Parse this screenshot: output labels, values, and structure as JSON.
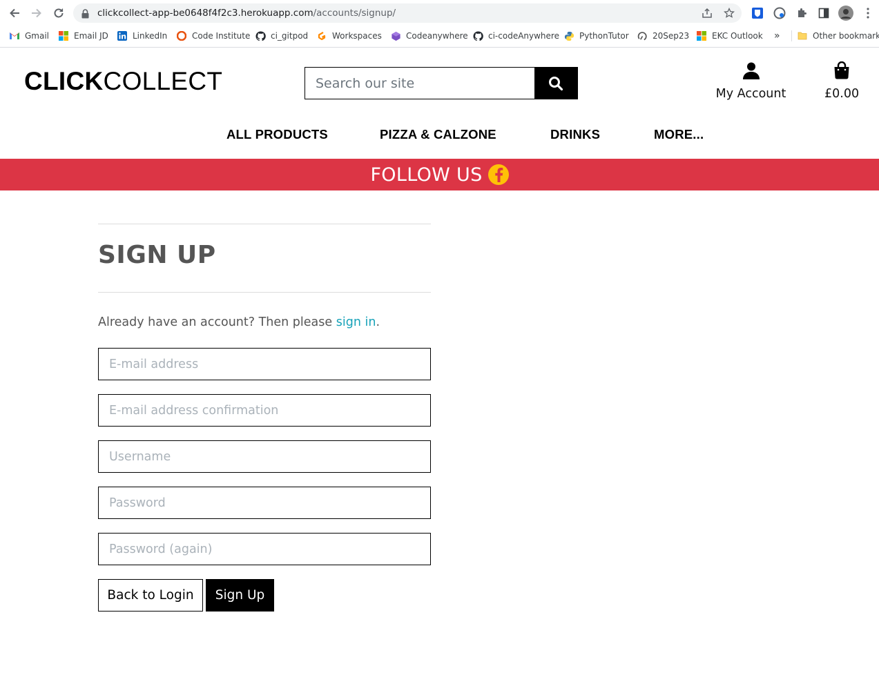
{
  "browser": {
    "url_host": "clickcollect-app-be0648f4f2c3.herokuapp.com",
    "url_path": "/accounts/signup/",
    "bookmarks": [
      {
        "label": "Gmail",
        "icon": "gmail-icon"
      },
      {
        "label": "Email JD",
        "icon": "microsoft-icon"
      },
      {
        "label": "LinkedIn",
        "icon": "linkedin-icon"
      },
      {
        "label": "Code Institute",
        "icon": "code-institute-icon"
      },
      {
        "label": "ci_gitpod",
        "icon": "github-icon"
      },
      {
        "label": "Workspaces",
        "icon": "gitpod-icon"
      },
      {
        "label": "Codeanywhere",
        "icon": "codeanywhere-icon"
      },
      {
        "label": "ci-codeAnywhere",
        "icon": "github-icon"
      },
      {
        "label": "PythonTutor",
        "icon": "python-icon"
      },
      {
        "label": "20Sep23",
        "icon": "loop-icon"
      },
      {
        "label": "EKC Outlook",
        "icon": "microsoft-icon"
      }
    ],
    "overflow_label": "»",
    "other_bookmarks": "Other bookmarks"
  },
  "header": {
    "logo_bold": "CLICK",
    "logo_light": "COLLECT",
    "search_placeholder": "Search our site",
    "account_label": "My Account",
    "bag_total": "£0.00"
  },
  "nav": {
    "items": [
      "ALL PRODUCTS",
      "PIZZA & CALZONE",
      "DRINKS",
      "MORE..."
    ]
  },
  "banner": {
    "text": "FOLLOW US",
    "color": "#dc3545",
    "icon": "facebook-icon"
  },
  "signup": {
    "title": "SIGN UP",
    "intro_prefix": "Already have an account? Then please ",
    "intro_link": "sign in",
    "intro_suffix": ".",
    "fields": [
      {
        "placeholder": "E-mail address",
        "value": ""
      },
      {
        "placeholder": "E-mail address confirmation",
        "value": ""
      },
      {
        "placeholder": "Username",
        "value": ""
      },
      {
        "placeholder": "Password",
        "value": ""
      },
      {
        "placeholder": "Password (again)",
        "value": ""
      }
    ],
    "back_label": "Back to Login",
    "submit_label": "Sign Up"
  }
}
